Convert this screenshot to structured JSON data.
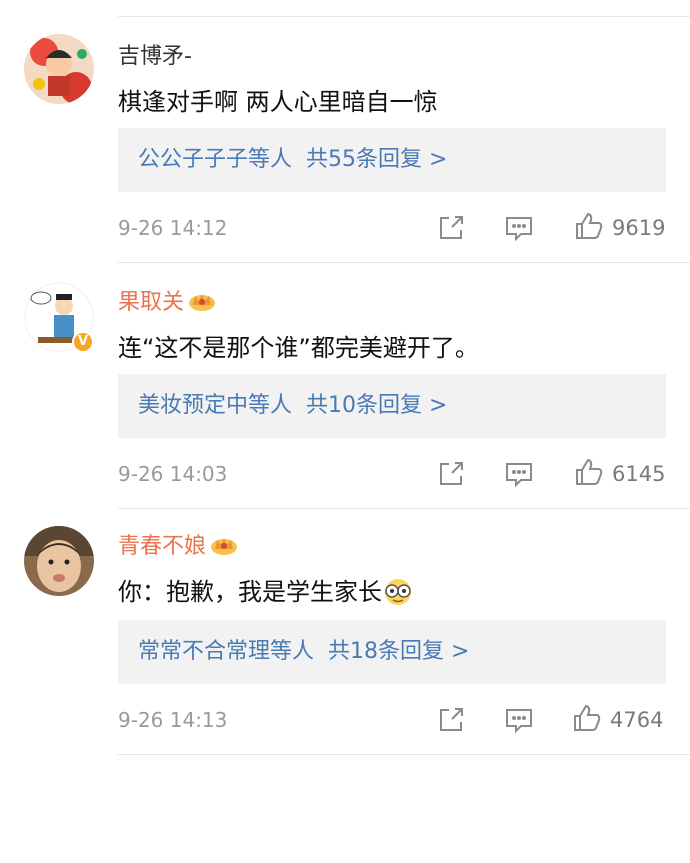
{
  "comments": [
    {
      "username": "吉博矛-",
      "vip": false,
      "verified": false,
      "text": "棋逢对手啊  两人心里暗自一惊",
      "reply_names": "公公子子子",
      "reply_suffix": "等人",
      "reply_count": "共55条回复 >",
      "timestamp": "9-26 14:12",
      "likes": "9619"
    },
    {
      "username": "果取关",
      "vip": true,
      "verified": true,
      "text": "连“这不是那个谁”都完美避开了。",
      "reply_names": "美妆预定中",
      "reply_suffix": "等人",
      "reply_count": "共10条回复 >",
      "timestamp": "9-26 14:03",
      "likes": "6145"
    },
    {
      "username": "青春不娘",
      "vip": true,
      "verified": false,
      "text": "你：抱歉，我是学生家长",
      "reply_names": "常常不合常理",
      "reply_suffix": "等人",
      "reply_count": "共18条回复 >",
      "timestamp": "9-26 14:13",
      "likes": "4764"
    }
  ],
  "colors": {
    "vip_name": "#eb7350",
    "link": "#4a7ab3",
    "meta": "#9a9a9a",
    "reply_bg": "#f2f2f2"
  },
  "icons": [
    "share-icon",
    "comment-icon",
    "like-icon",
    "vip-crown-icon",
    "verified-badge-icon",
    "glasses-emoji-icon"
  ]
}
